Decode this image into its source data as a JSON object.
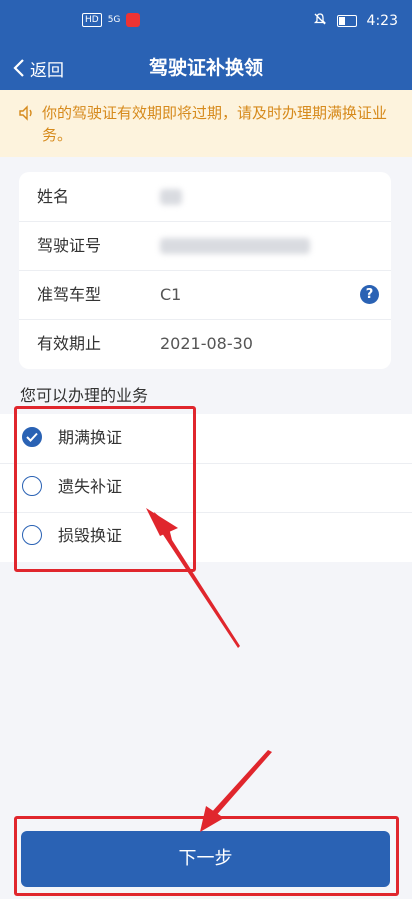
{
  "statusbar": {
    "left_badge": "HD",
    "signal": "5G",
    "time": "4:23"
  },
  "navbar": {
    "back_label": "返回",
    "title": "驾驶证补换领"
  },
  "notice": {
    "text": "你的驾驶证有效期即将过期，请及时办理期满换证业务。"
  },
  "license_info": {
    "rows": [
      {
        "label": "姓名",
        "value": ""
      },
      {
        "label": "驾驶证号",
        "value": ""
      },
      {
        "label": "准驾车型",
        "value": "C1"
      },
      {
        "label": "有效期止",
        "value": "2021-08-30"
      }
    ]
  },
  "services": {
    "title": "您可以办理的业务",
    "options": [
      {
        "label": "期满换证",
        "checked": true
      },
      {
        "label": "遗失补证",
        "checked": false
      },
      {
        "label": "损毁换证",
        "checked": false
      }
    ]
  },
  "next_button": "下一步",
  "colors": {
    "primary": "#2a62b4",
    "notice_bg": "#fdf3dd",
    "notice_text": "#d68a1c",
    "annotation_red": "#e0262d"
  }
}
